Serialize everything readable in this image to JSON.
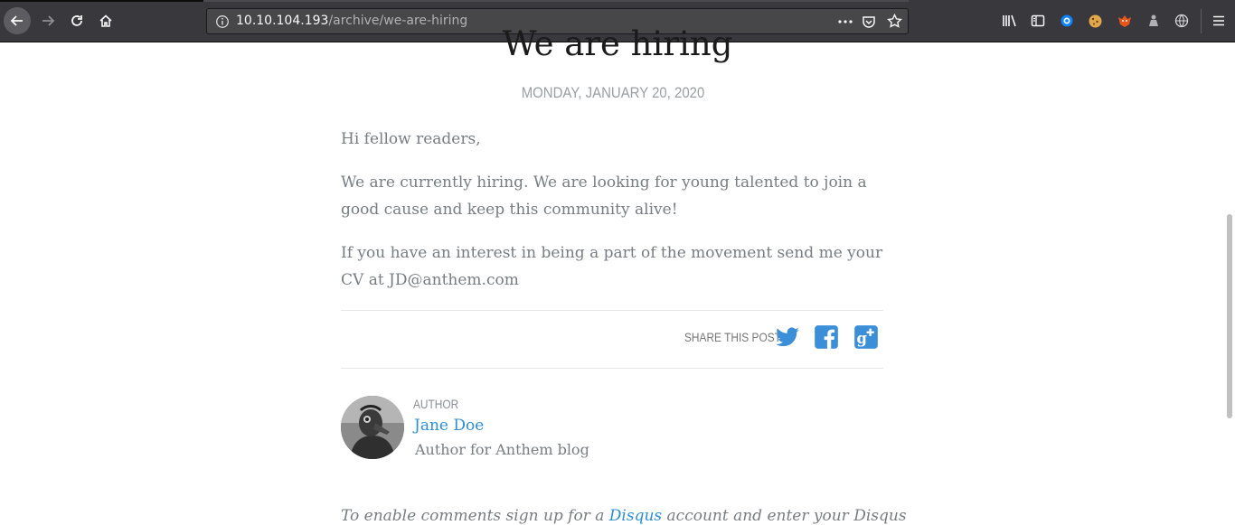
{
  "browser": {
    "url_host": "10.10.104.193",
    "url_path": "/archive/we-are-hiring"
  },
  "post": {
    "title": "We are hiring",
    "date": "MONDAY, JANUARY 20, 2020",
    "paragraphs": [
      "Hi fellow readers,",
      "We are currently hiring. We are looking for young talented to join a good cause and keep this community alive!",
      "If you have an interest in being a part of the movement send me your CV at JD@anthem.com"
    ]
  },
  "share": {
    "label": "SHARE THIS POST",
    "colors": {
      "twitter": "#55acee",
      "facebook": "#3b78c4",
      "googleplus": "#3b78c4"
    }
  },
  "author": {
    "label": "AUTHOR",
    "name": "Jane Doe",
    "bio": "Author for Anthem blog"
  },
  "comments": {
    "prefix": "To enable comments sign up for a ",
    "link": "Disqus",
    "suffix": " account and enter your Disqus"
  },
  "colors": {
    "link": "#2b8fd6",
    "body_text": "#777d82"
  }
}
